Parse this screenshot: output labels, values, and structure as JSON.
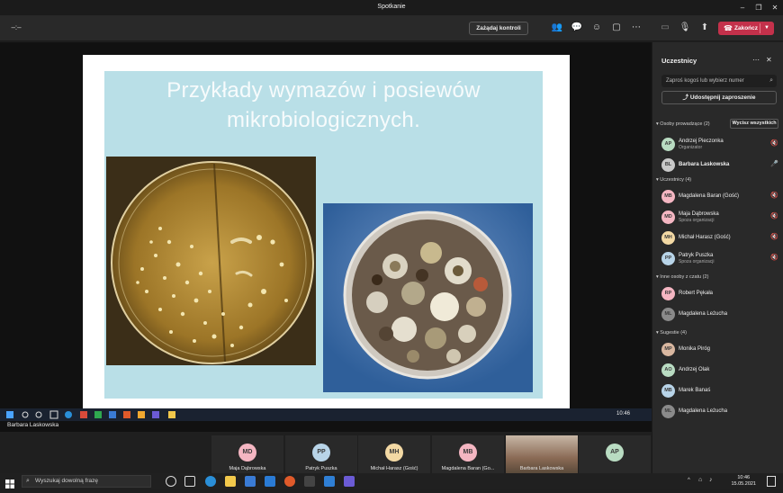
{
  "window": {
    "title": "Spotkanie"
  },
  "toolbar": {
    "control_label": "Zażądaj kontroli",
    "end_label": "Zakończ"
  },
  "slide": {
    "title_line1": "Przykłady wymazów i posiewów",
    "title_line2": "mikrobiologicznych."
  },
  "presenter": {
    "name": "Barbara Laskowska"
  },
  "gallery": [
    {
      "initials": "MD",
      "name": "Maja Dąbrowska",
      "color": "#f4b6c2"
    },
    {
      "initials": "PP",
      "name": "Patryk Puszka",
      "color": "#b8d4e8"
    },
    {
      "initials": "MH",
      "name": "Michał Harasz (Gość)",
      "color": "#f3d9a4"
    },
    {
      "initials": "MB",
      "name": "Magdalena Baran (Go...",
      "color": "#f4b6c2"
    },
    {
      "initials": "",
      "name": "Barbara Laskowska",
      "color": "#7a5a4a"
    },
    {
      "initials": "AP",
      "name": "",
      "color": "#b9dcc2"
    }
  ],
  "panel": {
    "title": "Uczestnicy",
    "search_placeholder": "Zaproś kogoś lub wybierz numer",
    "share_label": "Udostępnij zaproszenie",
    "mute_all_label": "Wycisz wszystkich",
    "sections": {
      "presenters": "Osoby prowadzące (2)",
      "attendees": "Uczestnicy (4)",
      "chat": "Inne osoby z czatu (2)",
      "suggestions": "Sugestie (4)"
    },
    "presenters": [
      {
        "initials": "AP",
        "name": "Andrzej Pieczonka",
        "sub": "Organizator",
        "color": "#b9dcc2"
      },
      {
        "initials": "BL",
        "name": "Barbara Laskowska",
        "sub": "",
        "color": "#c9c9c9"
      }
    ],
    "attendees": [
      {
        "initials": "MB",
        "name": "Magdalena Baran (Gość)",
        "sub": "",
        "color": "#f4b6c2"
      },
      {
        "initials": "MD",
        "name": "Maja Dąbrowska",
        "sub": "Spoza organizacji",
        "color": "#f4b6c2"
      },
      {
        "initials": "MH",
        "name": "Michał Harasz (Gość)",
        "sub": "",
        "color": "#f3d9a4"
      },
      {
        "initials": "PP",
        "name": "Patryk Puszka",
        "sub": "Spoza organizacji",
        "color": "#b8d4e8"
      }
    ],
    "chat": [
      {
        "initials": "RP",
        "name": "Robert Pękała",
        "color": "#f4b6c2"
      },
      {
        "initials": "ML",
        "name": "Magdalena Leżucha",
        "color": "#8a8a8a"
      }
    ],
    "suggestions": [
      {
        "initials": "MP",
        "name": "Monika Piróg",
        "color": "#d9b7a0"
      },
      {
        "initials": "AO",
        "name": "Andrzej Olak",
        "color": "#b9dcc2"
      },
      {
        "initials": "MB",
        "name": "Marek Banaś",
        "color": "#b8d4e8"
      },
      {
        "initials": "ML",
        "name": "Magdalena Leżucha",
        "color": "#8a8a8a"
      }
    ]
  },
  "screen_clock": "10:46",
  "os": {
    "search_placeholder": "Wyszukaj dowolną frazę",
    "time": "10:46",
    "date": "15.05.2021"
  }
}
